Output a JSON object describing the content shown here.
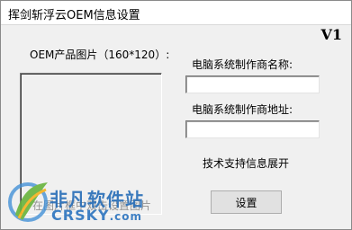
{
  "window": {
    "title": "挥剑斩浮云OEM信息设置",
    "version": "V1"
  },
  "oem_image": {
    "label": "OEM产品图片（160*120）:",
    "overlay_text": "在图片框中双击设置图片"
  },
  "manufacturer_name": {
    "label": "电脑系统制作商名称:",
    "value": ""
  },
  "manufacturer_address": {
    "label": "电脑系统制作商地址:",
    "value": ""
  },
  "support_info": {
    "label": "技术支持信息展开"
  },
  "buttons": {
    "settings_label": "设置"
  },
  "watermark": {
    "cn": "非凡软件站",
    "en": "CRSKY",
    "com": ".com"
  }
}
